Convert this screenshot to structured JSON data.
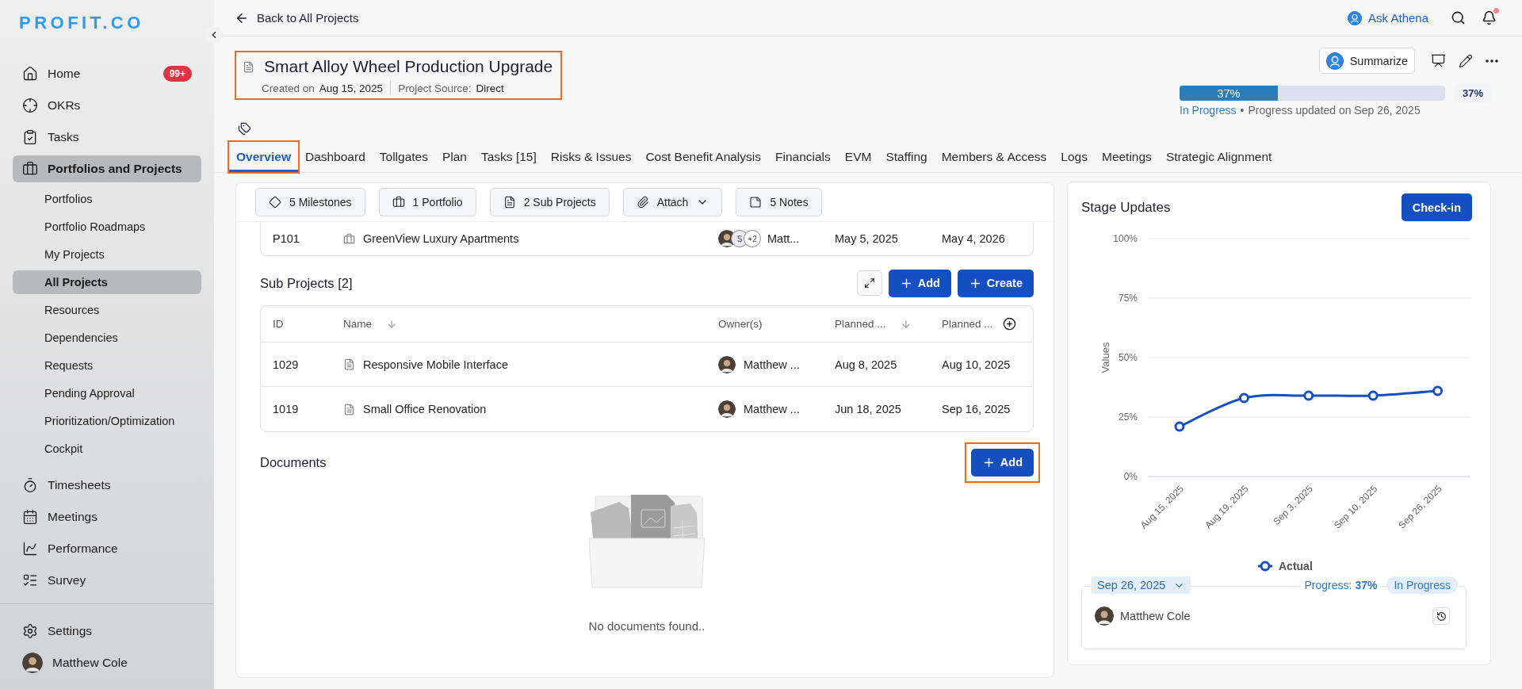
{
  "sidebar": {
    "logo": "PROFIT.CO",
    "nav": [
      {
        "label": "Home",
        "badge": "99+",
        "selected": false
      },
      {
        "label": "OKRs",
        "selected": false
      },
      {
        "label": "Tasks",
        "selected": false
      },
      {
        "label": "Portfolios and Projects",
        "selected": true,
        "children": [
          {
            "label": "Portfolios",
            "selected": false
          },
          {
            "label": "Portfolio Roadmaps",
            "selected": false
          },
          {
            "label": "My Projects",
            "selected": false
          },
          {
            "label": "All Projects",
            "selected": true
          },
          {
            "label": "Resources",
            "selected": false
          },
          {
            "label": "Dependencies",
            "selected": false
          },
          {
            "label": "Requests",
            "selected": false
          },
          {
            "label": "Pending Approval",
            "selected": false
          },
          {
            "label": "Prioritization/Optimization",
            "selected": false
          },
          {
            "label": "Cockpit",
            "selected": false
          }
        ]
      },
      {
        "label": "Timesheets",
        "selected": false
      },
      {
        "label": "Meetings",
        "selected": false
      },
      {
        "label": "Performance",
        "selected": false
      },
      {
        "label": "Survey",
        "selected": false
      }
    ],
    "settings": "Settings",
    "user": "Matthew Cole"
  },
  "header": {
    "back": "Back to All Projects",
    "ask": "Ask Athena",
    "unread": true
  },
  "project": {
    "title": "Smart Alloy Wheel Production Upgrade",
    "created_label": "Created on",
    "created": "Aug 15, 2025",
    "source_label": "Project Source:",
    "source": "Direct",
    "highlighted": true,
    "summarize": "Summarize"
  },
  "progress": {
    "level": 0.37,
    "bar_label": "37%",
    "value": "37%",
    "status": "In Progress",
    "separator": "•",
    "updated": "Progress updated on Sep 26, 2025"
  },
  "tabs": [
    {
      "label": "Overview",
      "selected": true,
      "highlighted": true
    },
    {
      "label": "Dashboard",
      "selected": false,
      "highlighted": false
    },
    {
      "label": "Tollgates",
      "selected": false,
      "highlighted": false
    },
    {
      "label": "Plan",
      "selected": false,
      "highlighted": false
    },
    {
      "label": "Tasks [15]",
      "selected": false,
      "highlighted": false
    },
    {
      "label": "Risks & Issues",
      "selected": false,
      "highlighted": false
    },
    {
      "label": "Cost Benefit Analysis",
      "selected": false,
      "highlighted": false
    },
    {
      "label": "Financials",
      "selected": false,
      "highlighted": false
    },
    {
      "label": "EVM",
      "selected": false,
      "highlighted": false
    },
    {
      "label": "Staffing",
      "selected": false,
      "highlighted": false
    },
    {
      "label": "Members & Access",
      "selected": false,
      "highlighted": false
    },
    {
      "label": "Logs",
      "selected": false,
      "highlighted": false
    },
    {
      "label": "Meetings",
      "selected": false,
      "highlighted": false
    },
    {
      "label": "Strategic Alignment",
      "selected": false,
      "highlighted": false
    }
  ],
  "toolbar": [
    {
      "label": "5 Milestones",
      "kind": "count"
    },
    {
      "label": "1 Portfolio",
      "kind": "count"
    },
    {
      "label": "2 Sub Projects",
      "kind": "count"
    },
    {
      "label": "Attach",
      "kind": "menu"
    },
    {
      "label": "5 Notes",
      "kind": "count"
    }
  ],
  "portfolio_row": {
    "id": "P101",
    "name": "GreenView Luxury Apartments",
    "owner_initial": "S",
    "owner_more": "+2",
    "owner": "Matt...",
    "start": "May 5, 2025",
    "end": "May 4, 2026"
  },
  "sub_projects": {
    "title": "Sub Projects [2]",
    "add": "Add",
    "create": "Create",
    "columns": [
      {
        "label": "ID",
        "sortable": false
      },
      {
        "label": "Name",
        "sortable": true
      },
      {
        "label": "Owner(s)",
        "sortable": false
      },
      {
        "label": "Planned ...",
        "sortable": true
      },
      {
        "label": "Planned ...",
        "sortable": false
      }
    ],
    "rows": [
      {
        "id": "1029",
        "name": "Responsive Mobile Interface",
        "owner": "Matthew ...",
        "start": "Aug 8, 2025",
        "end": "Aug 10, 2025"
      },
      {
        "id": "1019",
        "name": "Small Office Renovation",
        "owner": "Matthew ...",
        "start": "Jun 18, 2025",
        "end": "Sep 16, 2025"
      }
    ]
  },
  "documents": {
    "title": "Documents",
    "add": "Add",
    "add_highlighted": true,
    "empty": "No documents found.."
  },
  "stage_updates": {
    "title": "Stage Updates",
    "checkin": "Check-in",
    "chart_data": {
      "type": "line",
      "ylabel": "Values",
      "categories": [
        "Aug 15, 2025",
        "Aug 19, 2025",
        "Sep 3, 2025",
        "Sep 10, 2025",
        "Sep 26, 2025"
      ],
      "series": [
        {
          "name": "Actual",
          "color": "#1450c0",
          "marker": true,
          "values": [
            21,
            33,
            34,
            34,
            36
          ]
        }
      ],
      "grid": true,
      "ylim": [
        0,
        100
      ],
      "yticks": [
        {
          "value": 0,
          "label": "0%"
        },
        {
          "value": 25,
          "label": "25%"
        },
        {
          "value": 50,
          "label": "50%"
        },
        {
          "value": 75,
          "label": "75%"
        },
        {
          "value": 100,
          "label": "100%"
        }
      ]
    },
    "entry": {
      "date": "Sep 26, 2025",
      "progress_label": "Progress:",
      "progress_value": "37%",
      "status": "In Progress",
      "user": "Matthew Cole"
    }
  }
}
